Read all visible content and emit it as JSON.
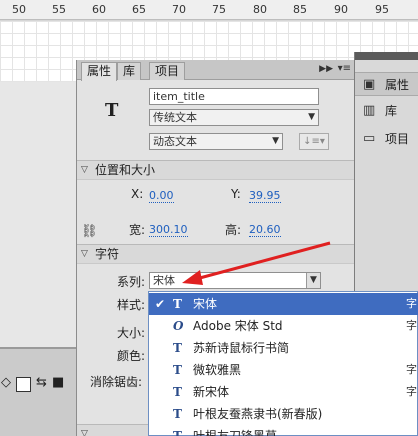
{
  "ruler": {
    "numbers": [
      "50",
      "55",
      "60",
      "65",
      "70",
      "75",
      "80",
      "85",
      "90",
      "95"
    ]
  },
  "tabs": {
    "properties": "属性",
    "library": "库",
    "project": "项目"
  },
  "instance": {
    "name_value": "item_title",
    "text_type": "传统文本",
    "text_behavior": "动态文本"
  },
  "position_size": {
    "section_title": "位置和大小",
    "x_label": "X:",
    "x_value": "0.00",
    "y_label": "Y:",
    "y_value": "39.95",
    "w_label": "宽:",
    "w_value": "300.10",
    "h_label": "高:",
    "h_value": "20.60"
  },
  "character": {
    "section_title": "字符",
    "family_label": "系列:",
    "family_value": "宋体",
    "style_label": "样式:",
    "size_label": "大小:",
    "color_label": "颜色:",
    "antialias_label": "消除锯齿:"
  },
  "font_list": [
    {
      "name": "宋体",
      "right": "字",
      "selected": true
    },
    {
      "name": "Adobe 宋体 Std",
      "right": "字",
      "selected": false
    },
    {
      "name": "苏新诗鼠标行书简",
      "right": "",
      "selected": false
    },
    {
      "name": "微软雅黑",
      "right": "字",
      "selected": false
    },
    {
      "name": "新宋体",
      "right": "字",
      "selected": false
    },
    {
      "name": "叶根友蚕燕隶书(新春版)",
      "right": "",
      "selected": false
    },
    {
      "name": "叶根友刀锋黑草",
      "right": "",
      "selected": false
    }
  ],
  "side_panel": {
    "properties": "属性",
    "library": "库",
    "project": "项目"
  },
  "colors": {
    "selection": "#3f6cc0",
    "value_link": "#1f5fbf",
    "annotation_arrow": "#e02020"
  }
}
